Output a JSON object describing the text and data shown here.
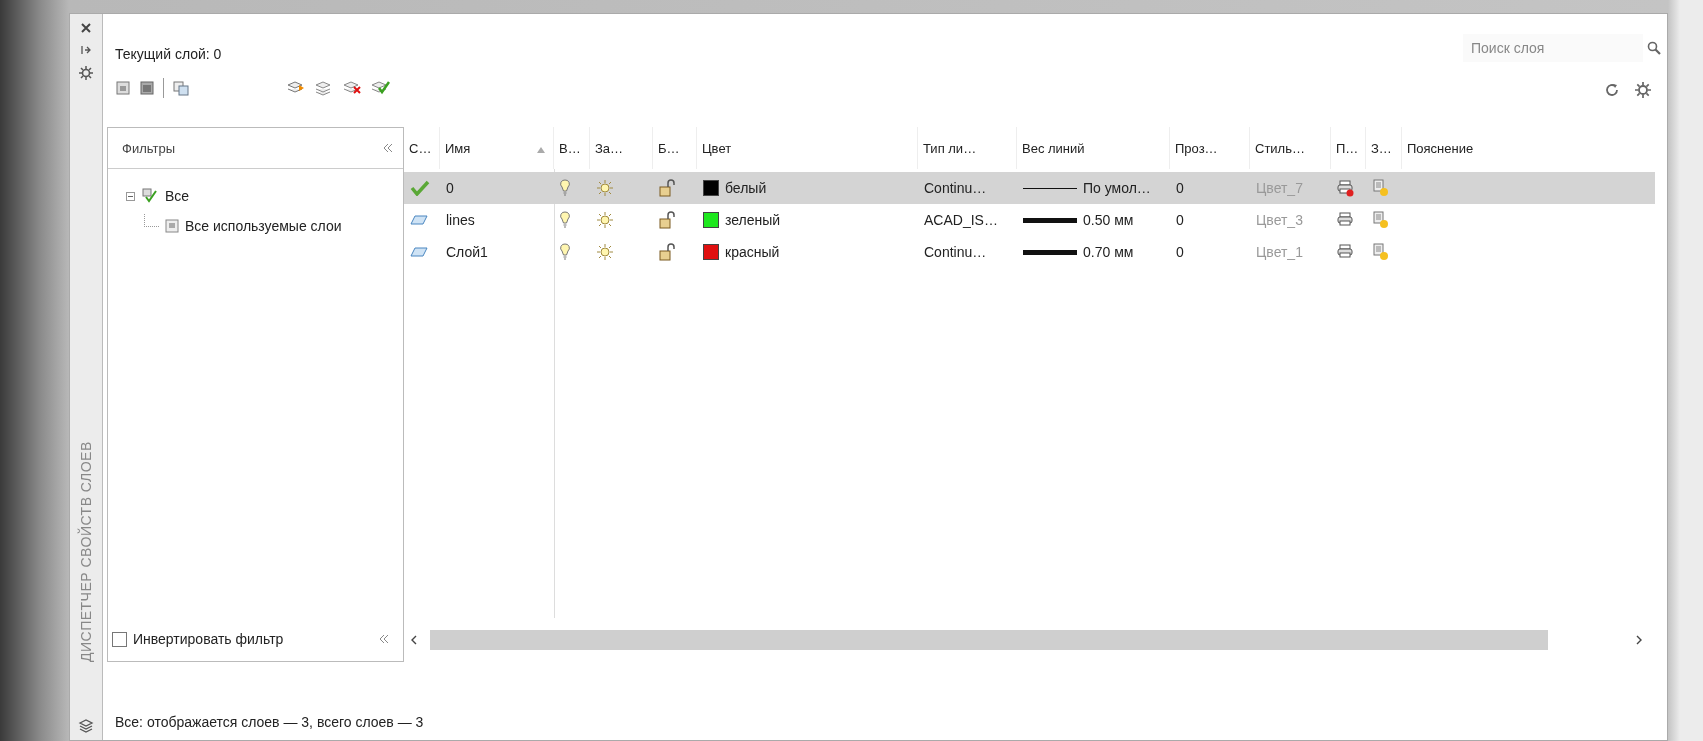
{
  "palette": {
    "title": "ДИСПЕТЧЕР СВОЙСТВ СЛОЕВ"
  },
  "current_layer": "Текущий слой: 0",
  "search": {
    "placeholder": "Поиск слоя"
  },
  "filters": {
    "title": "Фильтры",
    "tree": [
      {
        "label": "Все",
        "expanded": true,
        "children": [
          {
            "label": "Все используемые слои"
          }
        ]
      }
    ],
    "invert": {
      "label": "Инвертировать фильтр",
      "checked": false
    }
  },
  "table": {
    "columns": [
      {
        "label": "С…",
        "sorted": false
      },
      {
        "label": "Имя",
        "sorted": true
      },
      {
        "label": "В…",
        "sorted": false
      },
      {
        "label": "За…",
        "sorted": false
      },
      {
        "label": "Б…",
        "sorted": false
      },
      {
        "label": "Цвет",
        "sorted": false
      },
      {
        "label": "Тип ли…",
        "sorted": false
      },
      {
        "label": "Вес линий",
        "sorted": false
      },
      {
        "label": "Проз…",
        "sorted": false
      },
      {
        "label": "Стиль…",
        "sorted": false
      },
      {
        "label": "П…",
        "sorted": false
      },
      {
        "label": "З…",
        "sorted": false
      },
      {
        "label": "Пояснение",
        "sorted": false
      }
    ],
    "rows": [
      {
        "selected": true,
        "current": true,
        "name": "0",
        "on": true,
        "frozen": false,
        "locked": false,
        "color": "#000000",
        "color_name": "белый",
        "linetype": "Continu…",
        "thick_line": false,
        "lineweight": "По умол…",
        "transparency": "0",
        "plot_style": "Цвет_7",
        "plot": false
      },
      {
        "selected": false,
        "current": false,
        "name": "lines",
        "on": true,
        "frozen": false,
        "locked": false,
        "color": "#1ee81e",
        "color_name": "зеленый",
        "linetype": "ACAD_IS…",
        "thick_line": true,
        "lineweight": "0.50 мм",
        "transparency": "0",
        "plot_style": "Цвет_3",
        "plot": true
      },
      {
        "selected": false,
        "current": false,
        "name": "Слой1",
        "on": true,
        "frozen": false,
        "locked": false,
        "color": "#e01010",
        "color_name": "красный",
        "linetype": "Continu…",
        "thick_line": true,
        "lineweight": "0.70 мм",
        "transparency": "0",
        "plot_style": "Цвет_1",
        "plot": true
      }
    ]
  },
  "status_bar": "Все: отображается слоев — 3, всего слоев — 3"
}
